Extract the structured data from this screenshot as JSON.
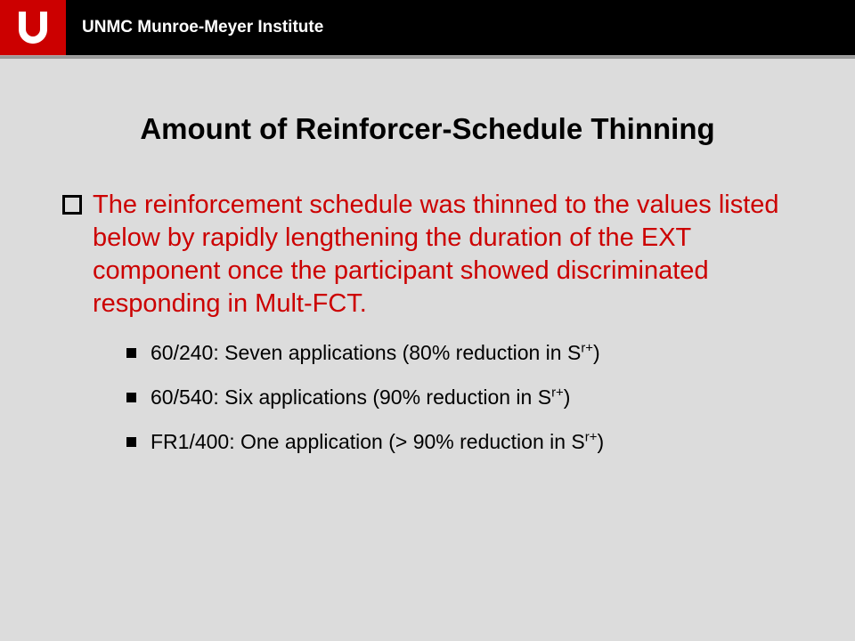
{
  "header": {
    "institute": "UNMC Munroe-Meyer Institute"
  },
  "slide": {
    "title": "Amount of Reinforcer-Schedule Thinning",
    "main_bullet": "The reinforcement schedule was thinned to the values listed below by rapidly lengthening the duration of the EXT component once the participant showed discriminated responding in Mult-FCT.",
    "sub_bullets": [
      {
        "prefix": "60/240: Seven applications (80% reduction in S",
        "sup": "r+",
        "suffix": ")"
      },
      {
        "prefix": "60/540: Six applications (90% reduction in S",
        "sup": "r+",
        "suffix": ")"
      },
      {
        "prefix": "FR1/400: One application (> 90% reduction in S",
        "sup": "r+",
        "suffix": ")"
      }
    ]
  }
}
